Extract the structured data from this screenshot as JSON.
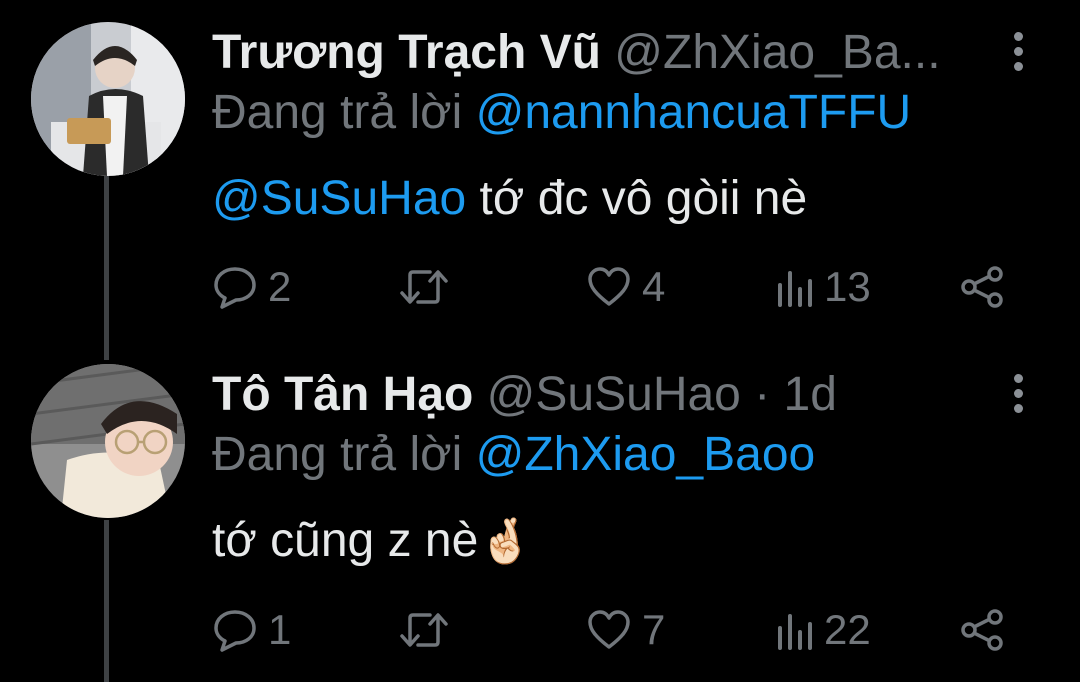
{
  "tweets": [
    {
      "name": "Trương Trạch Vũ",
      "handle": "@ZhXiao_Ba...",
      "replying_prefix": "Đang trả lời",
      "replying_to": "@nannhancuaTFFU",
      "text_mention": "@SuSuHao",
      "text": " tớ đc vô gòii nè",
      "replies": "2",
      "retweets": "",
      "likes": "4",
      "views": "13"
    },
    {
      "name": "Tô Tân Hạo",
      "handle": "@SuSuHao · 1d",
      "replying_prefix": "Đang trả lời",
      "replying_to": "@ZhXiao_Baoo",
      "text": "tớ cũng z nè",
      "emoji": "🤞🏻",
      "replies": "1",
      "retweets": "",
      "likes": "7",
      "views": "22"
    }
  ],
  "colors": {
    "background": "#000000",
    "name": "#e7e9ea",
    "secondary": "#71767b",
    "mention": "#1d9bf0",
    "thread_line": "#3e4144"
  },
  "icons": [
    "more-icon",
    "reply-icon",
    "retweet-icon",
    "like-icon",
    "views-icon",
    "share-icon"
  ]
}
